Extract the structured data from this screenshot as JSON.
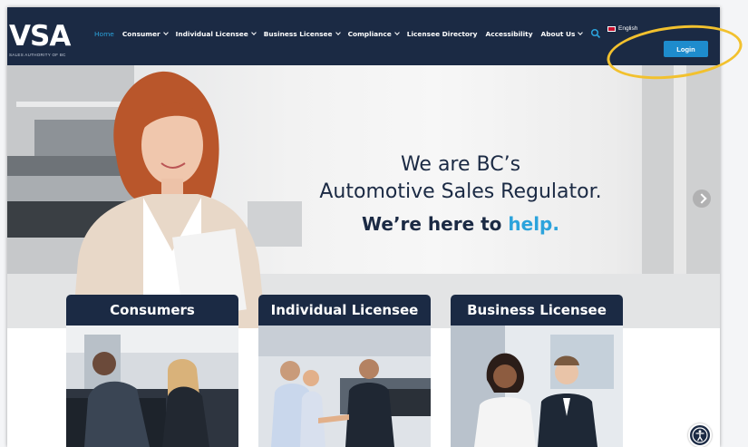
{
  "header": {
    "logo": {
      "mark": "VSA",
      "tagline": "SALES AUTHORITY OF BC"
    },
    "nav": [
      {
        "label": "Home",
        "active": true,
        "has_dropdown": false
      },
      {
        "label": "Consumer",
        "active": false,
        "has_dropdown": true
      },
      {
        "label": "Individual Licensee",
        "active": false,
        "has_dropdown": true
      },
      {
        "label": "Business Licensee",
        "active": false,
        "has_dropdown": true
      },
      {
        "label": "Compliance",
        "active": false,
        "has_dropdown": true
      },
      {
        "label": "Licensee Directory",
        "active": false,
        "has_dropdown": false
      },
      {
        "label": "Accessibility",
        "active": false,
        "has_dropdown": false
      },
      {
        "label": "About Us",
        "active": false,
        "has_dropdown": true
      }
    ],
    "search_icon": "search-icon",
    "language": {
      "label": "English",
      "flag_icon": "canada-flag-icon"
    },
    "login_label": "Login"
  },
  "hero": {
    "line1": "We are BC’s",
    "line2": "Automotive Sales Regulator.",
    "line3_prefix": "We’re here to ",
    "line3_highlight": "help."
  },
  "cards": [
    {
      "title": "Consumers"
    },
    {
      "title": "Individual Licensee"
    },
    {
      "title": "Business Licensee"
    }
  ],
  "colors": {
    "navy": "#1b2a44",
    "accent_blue": "#2ba3dc",
    "login_blue": "#1e8ccd",
    "highlight_ring": "#f2c12e"
  }
}
